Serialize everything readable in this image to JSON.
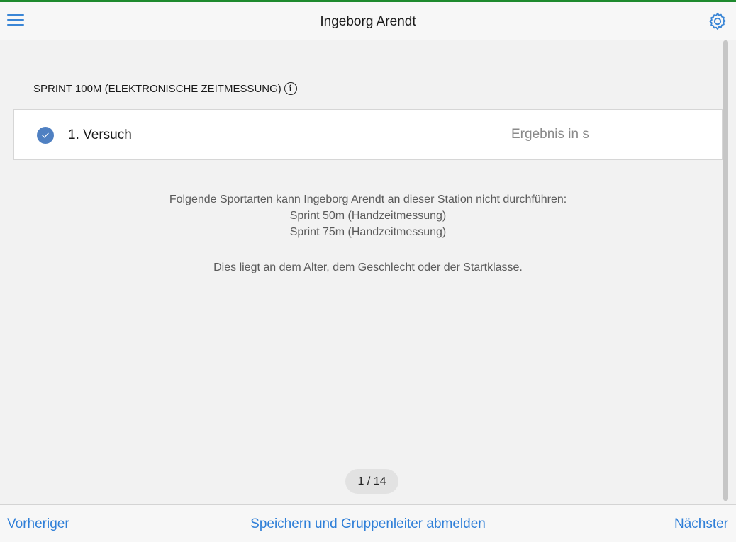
{
  "header": {
    "title": "Ingeborg Arendt",
    "menu_icon": "hamburger-menu-icon",
    "settings_icon": "gear-icon",
    "accent_color": "#3a86d6",
    "top_line_color": "#1e8a2e"
  },
  "section": {
    "title": "SPRINT 100M (ELEKTRONISCHE ZEITMESSUNG)",
    "info_icon": "info-icon",
    "info_glyph": "i"
  },
  "attempts": [
    {
      "label": "1. Versuch",
      "checked": true,
      "check_color": "#4f80c2",
      "result_value": "",
      "result_placeholder": "Ergebnis in s"
    }
  ],
  "notice": {
    "line1": "Folgende Sportarten kann Ingeborg Arendt an dieser Station nicht durchführen:",
    "sports": [
      "Sprint 50m (Handzeitmessung)",
      "Sprint 75m (Handzeitmessung)"
    ],
    "reason": "Dies liegt an dem Alter, dem Geschlecht oder der Startklasse."
  },
  "pagination": {
    "label": "1 / 14"
  },
  "footer": {
    "prev_label": "Vorheriger",
    "save_label": "Speichern und Gruppenleiter abmelden",
    "next_label": "Nächster"
  }
}
